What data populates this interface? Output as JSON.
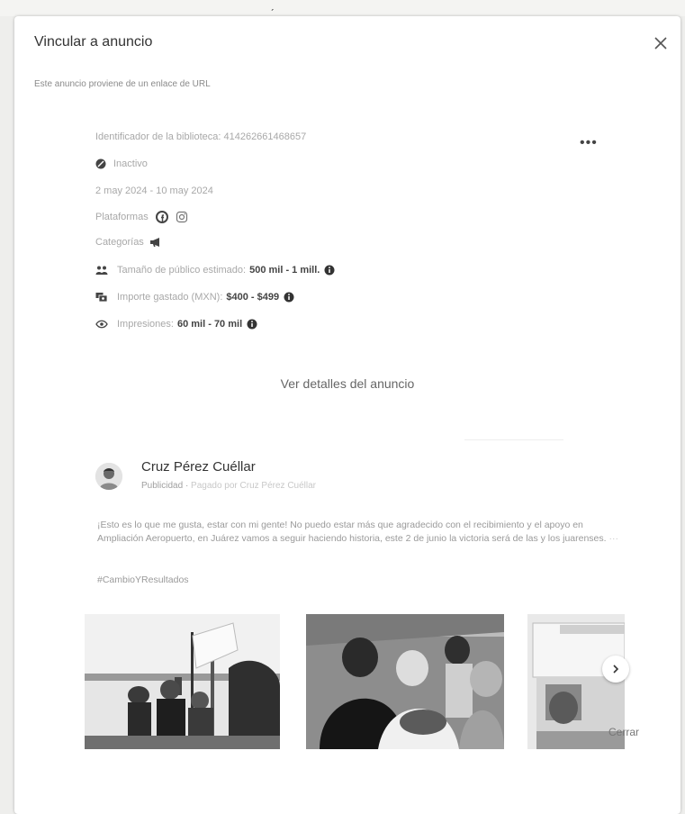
{
  "dialog": {
    "title": "Vincular a anuncio",
    "subtitle": "Este anuncio proviene de un enlace de URL",
    "close_button": "Cerrar"
  },
  "ad_info": {
    "library_id": "Identificador de la biblioteca: 414262661468657",
    "status": "Inactivo",
    "dates": "2 may 2024 - 10 may 2024",
    "platforms_label": "Plataformas",
    "categories_label": "Categorías",
    "audience_label": "Tamaño de público estimado:",
    "audience_value": "500 mil - 1 mill.",
    "spend_label": "Importe gastado (MXN):",
    "spend_value": "$400 - $499",
    "impressions_label": "Impresiones:",
    "impressions_value": "60 mil - 70 mil"
  },
  "details_link": "Ver detalles del anuncio",
  "ad": {
    "advertiser": "Cruz Pérez Cuéllar",
    "sponsored": "Publicidad",
    "paid_by": "Pagado por Cruz Pérez Cuéllar",
    "text": "¡Esto es lo que me gusta, estar con mi gente! No puedo estar más que agradecido con el recibimiento y el apoyo en Ampliación Aeropuerto, en Juárez vamos a seguir haciendo historia, este 2 de junio la victoria será de las y los juarenses.",
    "hashtag": "#CambioYResultados"
  },
  "icons": {
    "close": "close-icon",
    "more": "more-options-icon",
    "status": "inactive-icon",
    "facebook": "facebook-icon",
    "instagram": "instagram-icon",
    "megaphone": "megaphone-icon",
    "audience": "audience-icon",
    "money": "money-icon",
    "eye": "eye-icon",
    "info": "info-icon",
    "next": "chevron-right-icon"
  }
}
